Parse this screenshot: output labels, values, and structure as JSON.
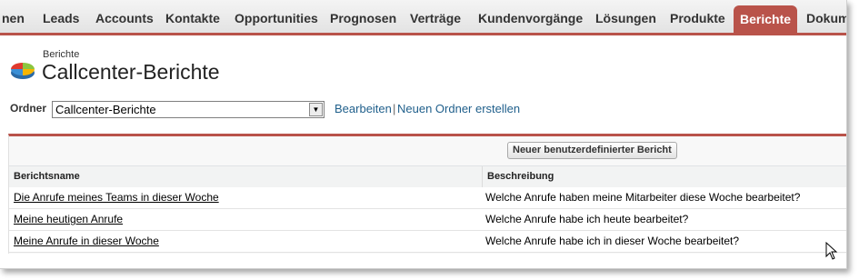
{
  "tabs": [
    {
      "label": "nen"
    },
    {
      "label": "Leads"
    },
    {
      "label": "Accounts"
    },
    {
      "label": "Kontakte"
    },
    {
      "label": "Opportunities"
    },
    {
      "label": "Prognosen"
    },
    {
      "label": "Verträge"
    },
    {
      "label": "Kundenvorgänge"
    },
    {
      "label": "Lösungen"
    },
    {
      "label": "Produkte"
    },
    {
      "label": "Berichte"
    },
    {
      "label": "Dokum"
    }
  ],
  "active_tab": "Berichte",
  "colors": {
    "accent": "#b9534a",
    "link": "#1f5f8b"
  },
  "header": {
    "subtitle": "Berichte",
    "title": "Callcenter-Berichte",
    "icon": "reports-pie-icon"
  },
  "folder": {
    "label": "Ordner",
    "selected": "Callcenter-Berichte",
    "edit_link": "Bearbeiten",
    "separator": "|",
    "new_folder_link": "Neuen Ordner erstellen"
  },
  "panel": {
    "new_report_button": "Neuer benutzerdefinierter Bericht",
    "columns": {
      "name": "Berichtsname",
      "description": "Beschreibung"
    },
    "rows": [
      {
        "name": "Die Anrufe meines Teams in dieser Woche",
        "description": "Welche Anrufe haben meine Mitarbeiter diese Woche bearbeitet?"
      },
      {
        "name": "Meine heutigen Anrufe",
        "description": "Welche Anrufe habe ich heute bearbeitet?"
      },
      {
        "name": "Meine Anrufe in dieser Woche",
        "description": "Welche Anrufe habe ich in dieser Woche bearbeitet?"
      }
    ]
  }
}
